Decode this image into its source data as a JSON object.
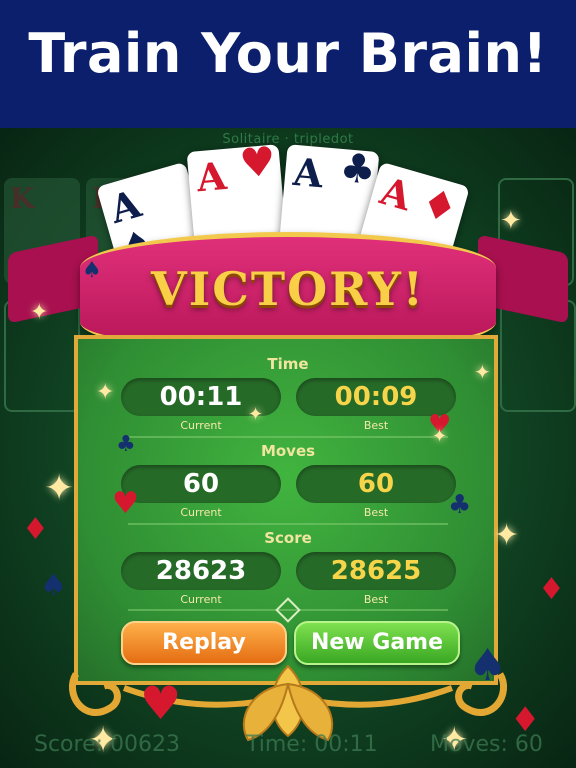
{
  "banner": {
    "title": "Train Your Brain!"
  },
  "app": {
    "brand": "Solitaire · tripledot"
  },
  "background_cards": [
    {
      "label": "K"
    },
    {
      "label": "K"
    }
  ],
  "fan_cards": [
    {
      "rank": "A",
      "suit": "♠",
      "color": "#0d1e4d"
    },
    {
      "rank": "A",
      "suit": "♥",
      "color": "#d6182f"
    },
    {
      "rank": "A",
      "suit": "♣",
      "color": "#0d1e4d"
    },
    {
      "rank": "A",
      "suit": "♦",
      "color": "#d6182f"
    }
  ],
  "ribbon": {
    "title": "VICTORY!"
  },
  "stats": {
    "time": {
      "title": "Time",
      "current": "00:11",
      "best": "00:09",
      "current_label": "Current",
      "best_label": "Best"
    },
    "moves": {
      "title": "Moves",
      "current": "60",
      "best": "60",
      "current_label": "Current",
      "best_label": "Best"
    },
    "score": {
      "title": "Score",
      "current": "28623",
      "best": "28625",
      "current_label": "Current",
      "best_label": "Best"
    }
  },
  "buttons": {
    "replay": "Replay",
    "new_game": "New Game"
  },
  "footer": {
    "score": "Score: 00623",
    "time": "Time: 00:11",
    "moves": "Moves: 60"
  },
  "colors": {
    "banner": "#0b1f6d",
    "ribbon": "#d02a6e",
    "accent_gold": "#f8cf46",
    "panel": "#35a138"
  }
}
